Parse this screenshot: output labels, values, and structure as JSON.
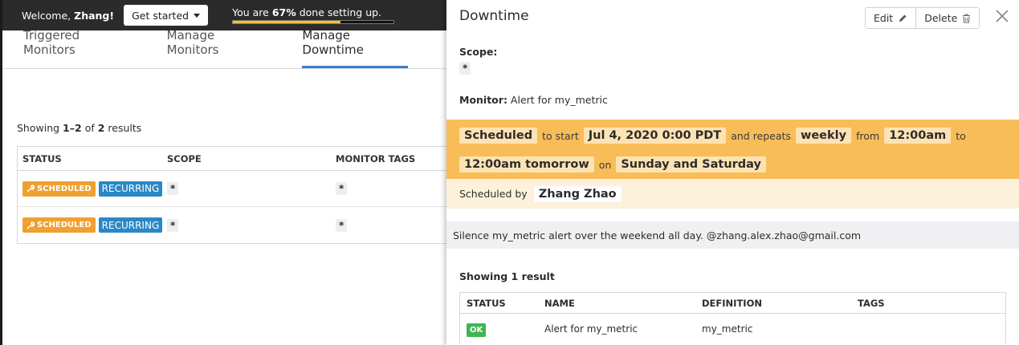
{
  "topbar": {
    "welcome_prefix": "Welcome,",
    "user_name": "Zhang!",
    "get_started_label": "Get started",
    "progress_prefix": "You are",
    "progress_percent_text": "67%",
    "progress_suffix": "done setting up.",
    "progress_value": 0.67
  },
  "tabs": [
    {
      "label": "Triggered Monitors"
    },
    {
      "label": "Manage Monitors"
    },
    {
      "label": "Manage Downtime"
    }
  ],
  "list": {
    "showing_prefix": "Showing",
    "range": "1–2",
    "of": "of",
    "total": "2",
    "suffix": "results",
    "columns": [
      "STATUS",
      "SCOPE",
      "MONITOR TAGS"
    ],
    "rows": [
      {
        "status": "SCHEDULED",
        "type": "RECURRING",
        "scope": "*",
        "tags": "*"
      },
      {
        "status": "SCHEDULED",
        "type": "RECURRING",
        "scope": "*",
        "tags": "*"
      }
    ]
  },
  "panel": {
    "title": "Downtime",
    "edit_label": "Edit",
    "delete_label": "Delete",
    "scope_label": "Scope:",
    "scope_value": "*",
    "monitor_label": "Monitor:",
    "monitor_value": "Alert for my_metric",
    "schedule": {
      "status": "Scheduled",
      "to_start": "to start",
      "start": "Jul 4, 2020 0:00 PDT",
      "and_repeats": "and repeats",
      "frequency": "weekly",
      "from": "from",
      "from_time": "12:00am",
      "to": "to",
      "to_time": "12:00am tomorrow",
      "on": "on",
      "days": "Sunday and Saturday"
    },
    "scheduled_by_label": "Scheduled by",
    "scheduled_by_name": "Zhang Zhao",
    "message": "Silence my_metric alert over the weekend all day. @zhang.alex.zhao@gmail.com",
    "showing": "Showing 1 result",
    "columns": [
      "STATUS",
      "NAME",
      "DEFINITION",
      "TAGS"
    ],
    "rows": [
      {
        "status": "OK",
        "name": "Alert for my_metric",
        "definition": "my_metric",
        "tags": ""
      }
    ]
  },
  "colors": {
    "schedule_band": "#f8bd59",
    "scheduled_badge": "#f0a030",
    "recurring_badge": "#2a88c6",
    "ok_badge": "#3fb553",
    "progress_fill": "#f2c037"
  }
}
